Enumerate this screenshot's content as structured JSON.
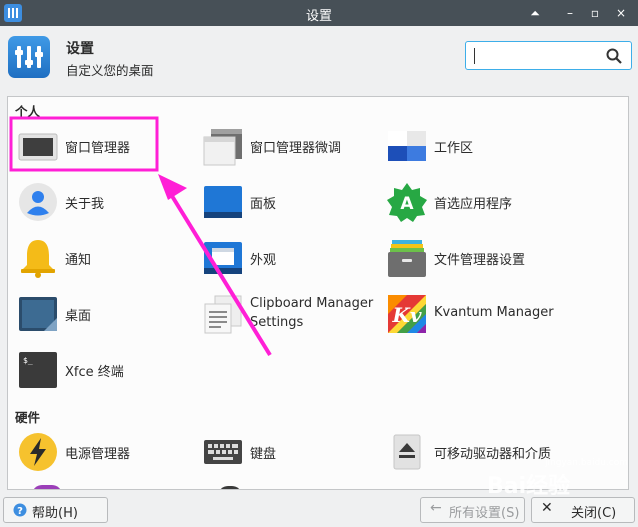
{
  "window": {
    "title": "设置"
  },
  "header": {
    "title": "设置",
    "subtitle": "自定义您的桌面",
    "search_value": ""
  },
  "sections": {
    "personal": {
      "title": "个人",
      "items": [
        {
          "label": "窗口管理器",
          "icon": "window-manager-icon"
        },
        {
          "label": "窗口管理器微调",
          "icon": "window-tweaks-icon"
        },
        {
          "label": "工作区",
          "icon": "workspaces-icon"
        },
        {
          "label": "关于我",
          "icon": "about-me-icon"
        },
        {
          "label": "面板",
          "icon": "panel-icon"
        },
        {
          "label": "首选应用程序",
          "icon": "preferred-apps-icon"
        },
        {
          "label": "通知",
          "icon": "bell-icon"
        },
        {
          "label": "外观",
          "icon": "appearance-icon"
        },
        {
          "label": "文件管理器设置",
          "icon": "file-manager-icon"
        },
        {
          "label": "桌面",
          "icon": "desktop-icon"
        },
        {
          "label": "Clipboard Manager Settings",
          "icon": "clipboard-icon"
        },
        {
          "label": "Kvantum Manager",
          "icon": "kvantum-icon"
        },
        {
          "label": "Xfce 终端",
          "icon": "terminal-icon"
        }
      ]
    },
    "hardware": {
      "title": "硬件",
      "items": [
        {
          "label": "电源管理器",
          "icon": "power-icon"
        },
        {
          "label": "键盘",
          "icon": "keyboard-icon"
        },
        {
          "label": "可移动驱动器和介质",
          "icon": "eject-icon"
        }
      ]
    }
  },
  "footer": {
    "help_label": "帮助(H)",
    "all_settings_label": "所有设置(S)",
    "close_label": "关闭(C)"
  },
  "watermark": {
    "text": "Bai经验",
    "sub": "jingyan.baidu.com"
  },
  "colors": {
    "titlebar": "#475057",
    "accent": "#3daee9",
    "annotation": "#ff1fd6"
  }
}
